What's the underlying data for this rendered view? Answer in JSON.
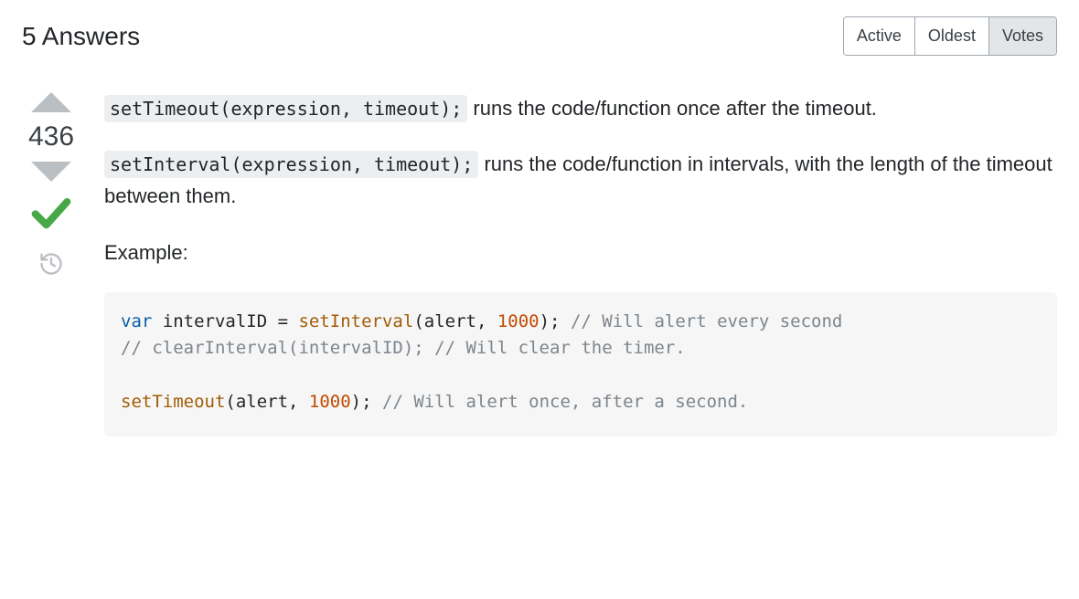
{
  "header": {
    "title": "5 Answers",
    "sort_tabs": [
      "Active",
      "Oldest",
      "Votes"
    ],
    "active_tab": 2
  },
  "answer": {
    "votes": "436",
    "accepted": true,
    "paragraphs": {
      "p1_code": "setTimeout(expression, timeout);",
      "p1_text": " runs the code/function once after the timeout.",
      "p2_code": "setInterval(expression, timeout);",
      "p2_text": " runs the code/function in intervals, with the length of the timeout between them.",
      "p3_text": "Example:"
    },
    "code_block": {
      "line1": {
        "kw": "var",
        "t1": " intervalID = ",
        "fn": "setInterval",
        "t2": "(alert, ",
        "num": "1000",
        "t3": "); ",
        "com": "// Will alert every second"
      },
      "line2": {
        "com": "// clearInterval(intervalID); // Will clear the timer."
      },
      "line3": {
        "fn": "setTimeout",
        "t1": "(alert, ",
        "num": "1000",
        "t2": "); ",
        "com": "// Will alert once, after a second."
      }
    }
  }
}
